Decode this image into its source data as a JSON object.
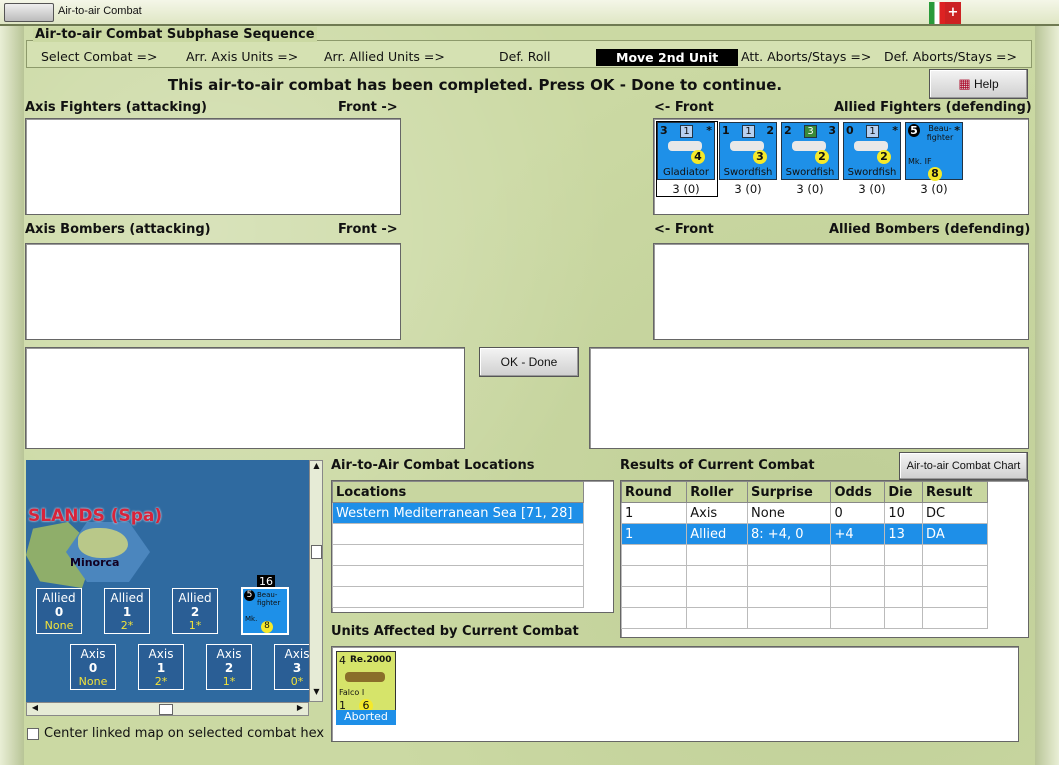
{
  "window": {
    "title": "Air-to-air Combat"
  },
  "sequence": {
    "title": "Air-to-air Combat Subphase Sequence",
    "steps": [
      "Select Combat =>",
      "Arr. Axis Units =>",
      "Arr. Allied Units =>",
      "Def. Roll",
      "Move 2nd Unit",
      "Att. Aborts/Stays =>",
      "Def. Aborts/Stays =>"
    ],
    "active_step": "Move 2nd Unit"
  },
  "message": "This air-to-air combat has been completed.  Press OK - Done to continue.",
  "help_label": "Help",
  "panels": {
    "axis_fighters": "Axis Fighters (attacking)",
    "axis_fighters_front": "Front ->",
    "allied_fighters_front": "<- Front",
    "allied_fighters": "Allied Fighters (defending)",
    "axis_bombers": "Axis Bombers (attacking)",
    "axis_bombers_front": "Front ->",
    "allied_bombers_front": "<- Front",
    "allied_bombers": "Allied Bombers (defending)"
  },
  "allied_fighter_units": [
    {
      "name": "Gladiator",
      "tl": "3",
      "box": "1",
      "tr": "*",
      "roll": "4",
      "value": "3 (0)"
    },
    {
      "name": "Swordfish",
      "tl": "1",
      "box": "1",
      "tr": "2",
      "roll": "3",
      "value": "3 (0)"
    },
    {
      "name": "Swordfish",
      "tl": "2",
      "box": "3",
      "tr": "3",
      "roll": "2",
      "value": "3 (0)"
    },
    {
      "name": "Swordfish",
      "tl": "0",
      "box": "1",
      "tr": "*",
      "roll": "2",
      "value": "3 (0)"
    },
    {
      "name": "Mk. IF",
      "tl": "5",
      "box": "Beau-fighter",
      "tr": "*",
      "roll": "8",
      "value": "3 (0)"
    }
  ],
  "ok_done_label": "OK - Done",
  "map": {
    "region": "SLANDS (Spa)",
    "island": "Minorca",
    "stack_count": "16",
    "allied_boxes": [
      {
        "label": "Allied",
        "num": "0",
        "sub": "None"
      },
      {
        "label": "Allied",
        "num": "1",
        "sub": "2*"
      },
      {
        "label": "Allied",
        "num": "2",
        "sub": "1*"
      }
    ],
    "axis_boxes": [
      {
        "label": "Axis",
        "num": "0",
        "sub": "None"
      },
      {
        "label": "Axis",
        "num": "1",
        "sub": "2*"
      },
      {
        "label": "Axis",
        "num": "2",
        "sub": "1*"
      },
      {
        "label": "Axis",
        "num": "3",
        "sub": "0*"
      }
    ],
    "stack_unit": {
      "tl": "5",
      "name": "Beau-fighter",
      "sub": "Mk.",
      "roll": "8"
    }
  },
  "center_map_label": "Center linked map on selected combat hex",
  "locations": {
    "title": "Air-to-Air Combat Locations",
    "header": "Locations",
    "rows": [
      "Western Mediterranean Sea [71, 28]"
    ]
  },
  "results": {
    "title": "Results of Current Combat",
    "chart_button": "Air-to-air Combat Chart",
    "headers": [
      "Round",
      "Roller",
      "Surprise",
      "Odds",
      "Die",
      "Result"
    ],
    "rows": [
      [
        "1",
        "Axis",
        "None",
        "0",
        "10",
        "DC"
      ],
      [
        "1",
        "Allied",
        "8: +4, 0",
        "+4",
        "13",
        "DA"
      ]
    ]
  },
  "affected": {
    "title": "Units Affected by Current Combat",
    "unit": {
      "tl": "4",
      "name": "Re.2000",
      "sub": "Falco I",
      "bl": "1",
      "roll": "6",
      "status": "Aborted"
    }
  }
}
